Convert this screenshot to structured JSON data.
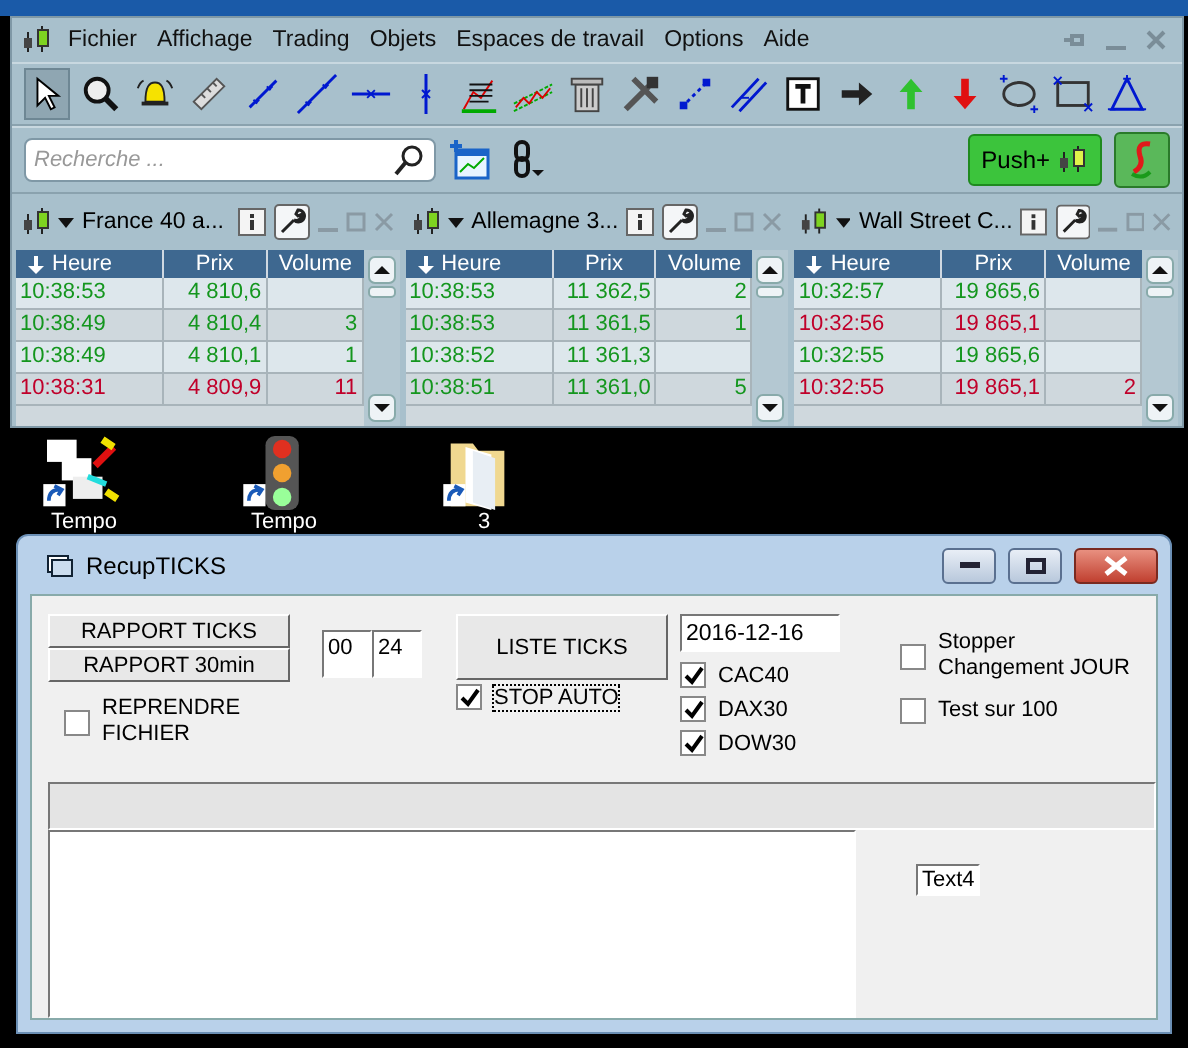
{
  "app": {
    "menu": [
      "Fichier",
      "Affichage",
      "Trading",
      "Objets",
      "Espaces de travail",
      "Options",
      "Aide"
    ],
    "toolbar": [
      {
        "kind": "pointer",
        "selected": true
      },
      {
        "kind": "zoom",
        "selected": false
      },
      {
        "kind": "bell",
        "selected": false
      },
      {
        "kind": "ruler",
        "selected": false
      },
      {
        "kind": "segment",
        "selected": false
      },
      {
        "kind": "line",
        "selected": false
      },
      {
        "kind": "hline",
        "selected": false
      },
      {
        "kind": "vline",
        "selected": false
      },
      {
        "kind": "chart",
        "selected": false
      },
      {
        "kind": "channel",
        "selected": false
      },
      {
        "kind": "trash",
        "selected": false
      },
      {
        "kind": "tools",
        "selected": false
      },
      {
        "kind": "dotted",
        "selected": false
      },
      {
        "kind": "parallel",
        "selected": false
      },
      {
        "kind": "text",
        "selected": false
      },
      {
        "kind": "arrow-right",
        "selected": false
      },
      {
        "kind": "arrow-up",
        "selected": false
      },
      {
        "kind": "arrow-down",
        "selected": false
      },
      {
        "kind": "ellipse",
        "selected": false
      },
      {
        "kind": "rectangle",
        "selected": false
      },
      {
        "kind": "triangle",
        "selected": false
      }
    ],
    "search": {
      "placeholder": "Recherche ..."
    },
    "push_button": "Push+",
    "panels": [
      {
        "title": "France 40 a...",
        "columns": [
          "Heure",
          "Prix",
          "Volume"
        ],
        "rows": [
          {
            "time": "10:38:53",
            "price": "4 810,6",
            "rising": true
          },
          {
            "time": "10:38:49",
            "price": "4 810,4",
            "volume": "3",
            "rising": true
          },
          {
            "time": "10:38:49",
            "price": "4 810,1",
            "volume": "1",
            "rising": true
          },
          {
            "time": "10:38:31",
            "price": "4 809,9",
            "volume": "11",
            "rising": false
          }
        ]
      },
      {
        "title": "Allemagne 3...",
        "columns": [
          "Heure",
          "Prix",
          "Volume"
        ],
        "rows": [
          {
            "time": "10:38:53",
            "price": "11 362,5",
            "volume": "2",
            "rising": true
          },
          {
            "time": "10:38:53",
            "price": "11 361,5",
            "volume": "1",
            "rising": true
          },
          {
            "time": "10:38:52",
            "price": "11 361,3",
            "rising": true
          },
          {
            "time": "10:38:51",
            "price": "11 361,0",
            "volume": "5",
            "rising": true
          }
        ]
      },
      {
        "title": "Wall Street C...",
        "columns": [
          "Heure",
          "Prix",
          "Volume"
        ],
        "rows": [
          {
            "time": "10:32:57",
            "price": "19 865,6",
            "rising": true
          },
          {
            "time": "10:32:56",
            "price": "19 865,1",
            "rising": false
          },
          {
            "time": "10:32:55",
            "price": "19 865,6",
            "rising": true
          },
          {
            "time": "10:32:55",
            "price": "19 865,1",
            "volume": "2",
            "rising": false
          }
        ]
      }
    ]
  },
  "desktop": {
    "icons": [
      {
        "kind": "documents",
        "label": "Tempo"
      },
      {
        "kind": "traffic-light",
        "label": "Tempo"
      },
      {
        "kind": "folder",
        "label": "3"
      }
    ]
  },
  "dialog": {
    "title": "RecupTICKS",
    "report_buttons": [
      "RAPPORT TICKS",
      "RAPPORT 30min"
    ],
    "hour_fields": [
      "00",
      "24"
    ],
    "list_button": "LISTE TICKS",
    "date": "2016-12-16",
    "reprendre": {
      "label": "REPRENDRE FICHIER",
      "checked": false
    },
    "stop_auto": {
      "label": "STOP AUTO",
      "checked": true,
      "focused": true
    },
    "markets": [
      {
        "label": "CAC40",
        "checked": true
      },
      {
        "label": "DAX30",
        "checked": true
      },
      {
        "label": "DOW30",
        "checked": true
      }
    ],
    "options": [
      {
        "label": "Stopper Changement JOUR",
        "checked": false
      },
      {
        "label": "Test sur 100",
        "checked": false
      }
    ],
    "text4": "Text4"
  }
}
